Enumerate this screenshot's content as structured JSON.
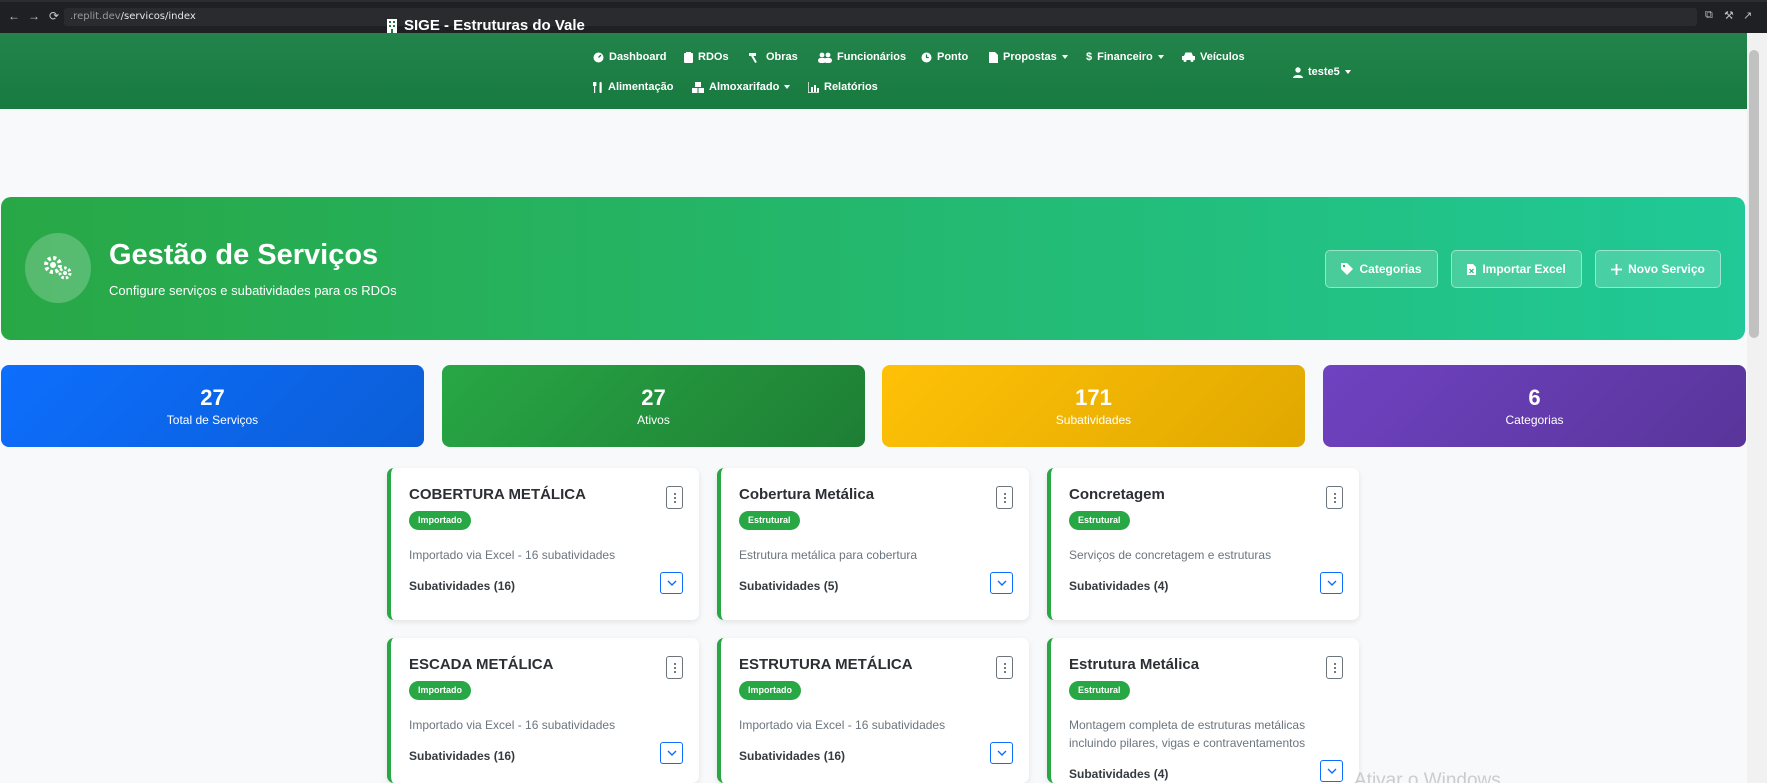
{
  "browser": {
    "url_host": ".replit.dev",
    "url_path": "/servicos/index"
  },
  "navbar": {
    "brand": "SIGE - Estruturas do Vale",
    "items": [
      {
        "label": "Dashboard"
      },
      {
        "label": "RDOs"
      },
      {
        "label": "Obras"
      },
      {
        "label": "Funcionários"
      },
      {
        "label": "Ponto"
      },
      {
        "label": "Propostas"
      },
      {
        "label": "Financeiro"
      },
      {
        "label": "Veículos"
      },
      {
        "label": "Alimentação"
      },
      {
        "label": "Almoxarifado"
      },
      {
        "label": "Relatórios"
      }
    ],
    "user": "teste5"
  },
  "header": {
    "title": "Gestão de Serviços",
    "subtitle": "Configure serviços e subatividades para os RDOs",
    "buttons": {
      "categorias": "Categorias",
      "importar": "Importar Excel",
      "novo": "Novo Serviço"
    }
  },
  "stats": [
    {
      "value": "27",
      "label": "Total de Serviços",
      "color": "#0d6efd"
    },
    {
      "value": "27",
      "label": "Ativos",
      "color": "#28a745"
    },
    {
      "value": "171",
      "label": "Subatividades",
      "color": "#ffc107"
    },
    {
      "value": "6",
      "label": "Categorias",
      "color": "#6f42c1"
    }
  ],
  "cards": [
    {
      "title": "COBERTURA METÁLICA",
      "badge": "Importado",
      "description": "Importado via Excel - 16 subatividades",
      "subatividades": "Subatividades (16)"
    },
    {
      "title": "Cobertura Metálica",
      "badge": "Estrutural",
      "description": "Estrutura metálica para cobertura",
      "subatividades": "Subatividades (5)"
    },
    {
      "title": "Concretagem",
      "badge": "Estrutural",
      "description": "Serviços de concretagem e estruturas",
      "subatividades": "Subatividades (4)"
    },
    {
      "title": "ESCADA METÁLICA",
      "badge": "Importado",
      "description": "Importado via Excel - 16 subatividades",
      "subatividades": "Subatividades (16)"
    },
    {
      "title": "ESTRUTURA METÁLICA",
      "badge": "Importado",
      "description": "Importado via Excel - 16 subatividades",
      "subatividades": "Subatividades (16)"
    },
    {
      "title": "Estrutura Metálica",
      "badge": "Estrutural",
      "description": "Montagem completa de estruturas metálicas incluindo pilares, vigas e contraventamentos",
      "subatividades": "Subatividades (4)"
    }
  ],
  "watermark": "Ativar o Windows"
}
